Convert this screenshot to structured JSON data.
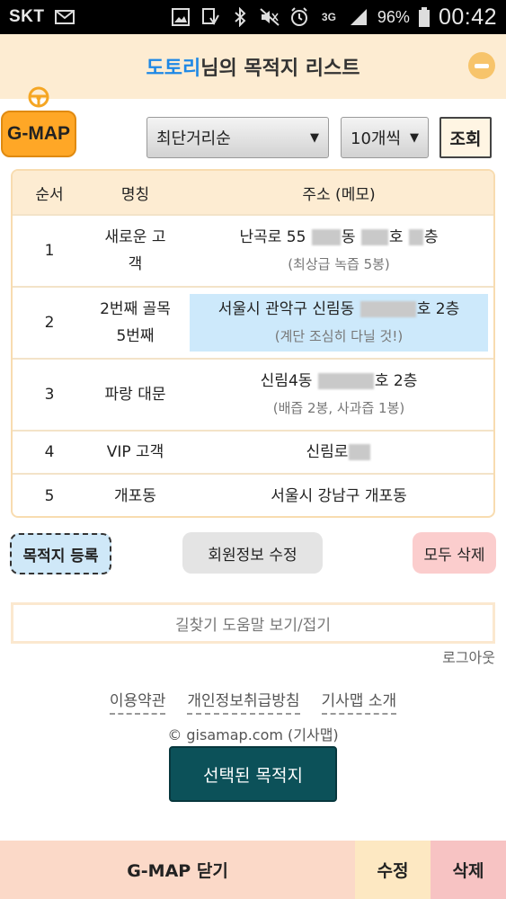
{
  "status_bar": {
    "carrier": "SKT",
    "battery": "96%",
    "time": "00:42",
    "icons": [
      "mail-icon",
      "image-icon",
      "download-icon",
      "bluetooth-icon",
      "mute-icon",
      "alarm-icon",
      "3g-icon",
      "signal-icon",
      "battery-icon"
    ]
  },
  "header": {
    "name": "도토리",
    "title_rest": "님의 목적지 리스트"
  },
  "toolbar": {
    "gmap_label": "G-MAP",
    "sort_value": "최단거리순",
    "count_value": "10개씩",
    "search_label": "조회"
  },
  "table": {
    "columns": [
      "순서",
      "명칭",
      "주소 (메모)"
    ],
    "rows": [
      {
        "no": "1",
        "name_lines": [
          "새로운 고",
          "객"
        ],
        "addr_parts": [
          "난곡로 55",
          "동",
          "호",
          "층"
        ],
        "memo": "(최상급 녹즙 5봉)"
      },
      {
        "no": "2",
        "name_lines": [
          "2번째 골목",
          "5번째"
        ],
        "addr_parts": [
          "서울시 관악구 신림동",
          "호 2층"
        ],
        "memo": "(계단 조심히 다닐 것!)"
      },
      {
        "no": "3",
        "name_lines": [
          "파랑 대문"
        ],
        "addr_parts": [
          "신림4동",
          "호 2층"
        ],
        "memo": "(배즙 2봉, 사과즙 1봉)"
      },
      {
        "no": "4",
        "name_lines": [
          "VIP 고객"
        ],
        "addr_parts": [
          "신림로"
        ],
        "memo": ""
      },
      {
        "no": "5",
        "name_lines": [
          "개포동"
        ],
        "addr_parts": [
          "서울시 강남구 개포동"
        ],
        "memo": ""
      }
    ]
  },
  "actions": {
    "register": "목적지 등록",
    "member_edit": "회원정보 수정",
    "delete_all": "모두 삭제"
  },
  "help": {
    "toggle": "길찾기 도움말 보기/접기",
    "logout": "로그아웃"
  },
  "footer": {
    "links": [
      "이용약관",
      "개인정보취급방침",
      "기사맵 소개"
    ],
    "copyright": "© gisamap.com (기사맵)",
    "selected_button": "선택된 목적지"
  },
  "bottom_bar": {
    "close": "G-MAP 닫기",
    "edit": "수정",
    "delete": "삭제"
  }
}
